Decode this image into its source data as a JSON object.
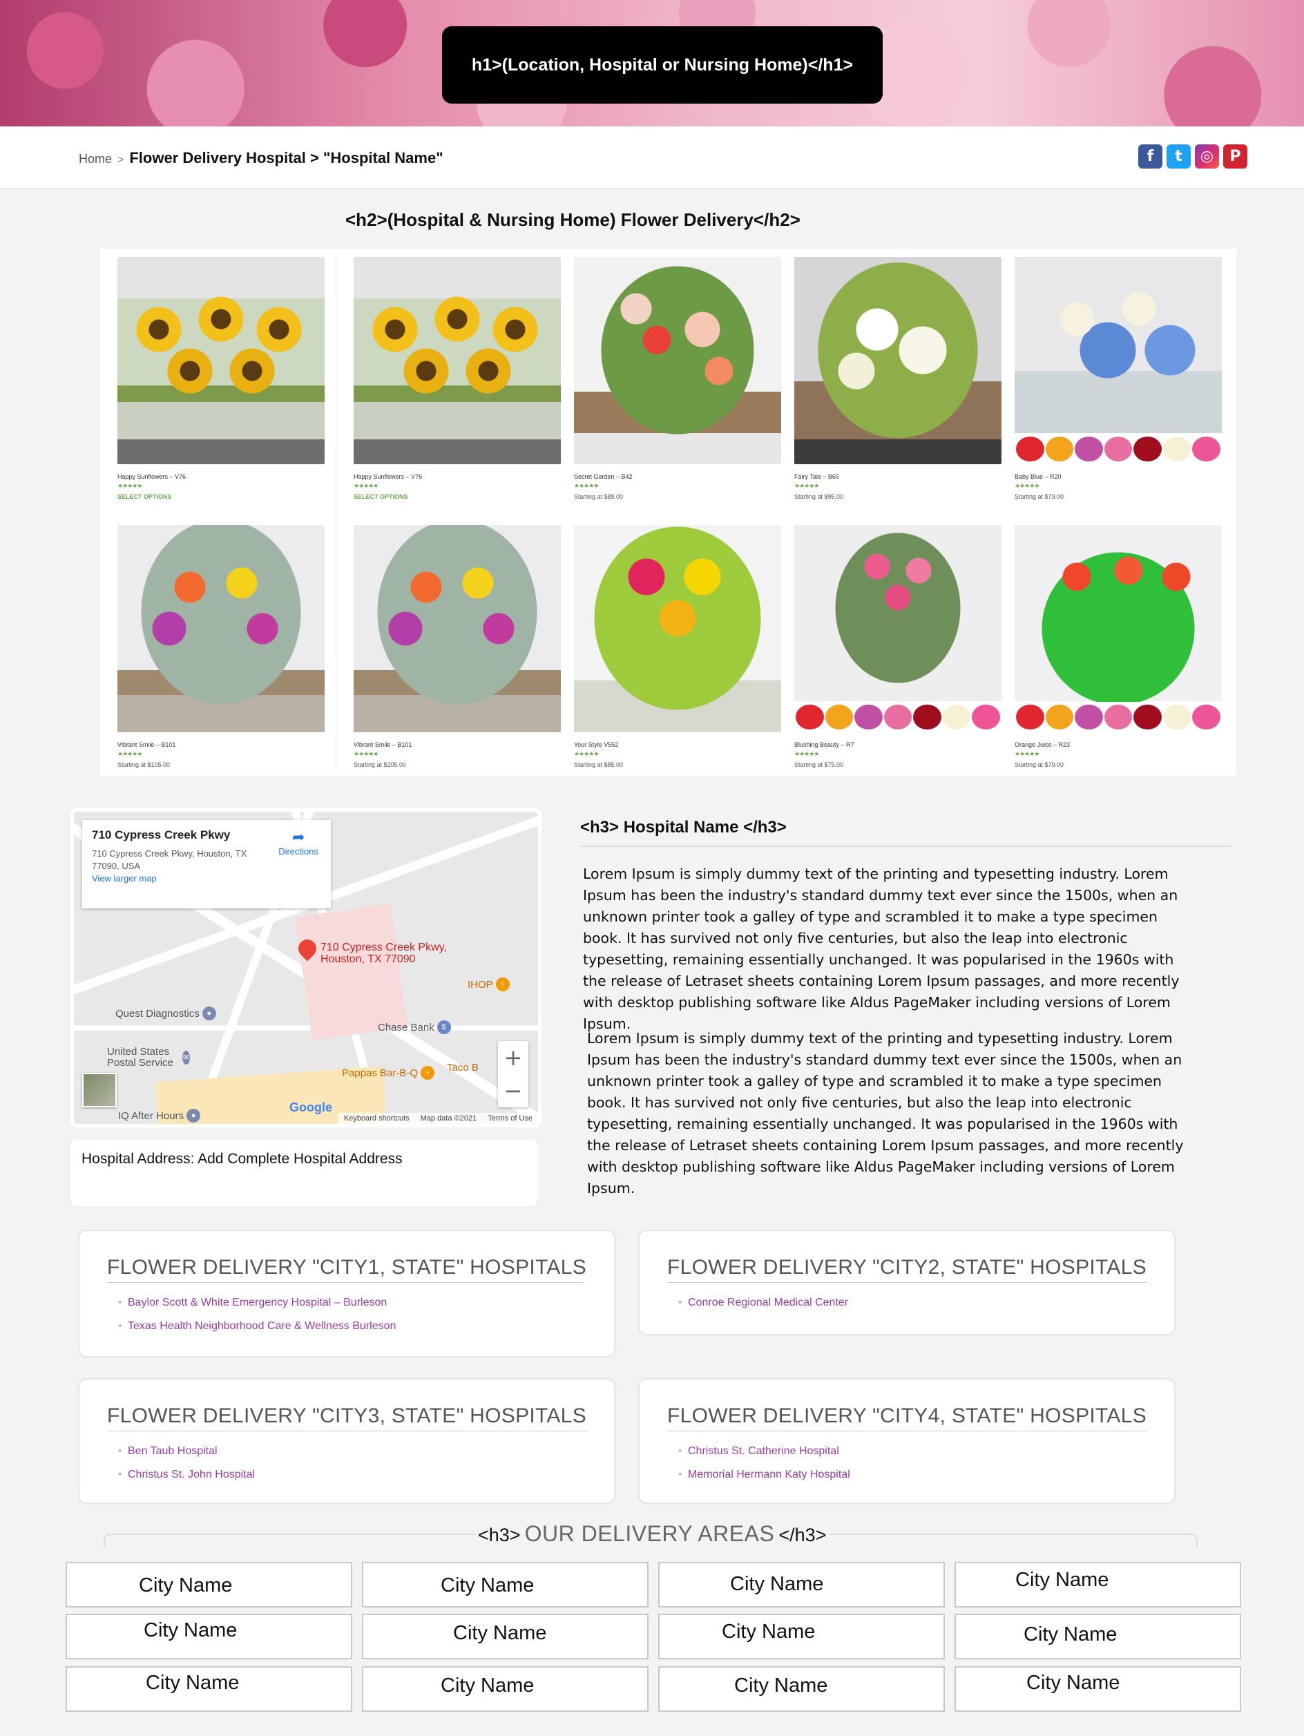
{
  "hero": {
    "title": "h1>(Location, Hospital or Nursing Home)</h1>"
  },
  "breadcrumb": {
    "home": "Home",
    "sep": ">",
    "current": "Flower Delivery Hospital > \"Hospital Name\""
  },
  "social": [
    {
      "name": "facebook",
      "glyph": "f"
    },
    {
      "name": "twitter",
      "glyph": "t"
    },
    {
      "name": "instagram",
      "glyph": "◎"
    },
    {
      "name": "pinterest",
      "glyph": "P"
    }
  ],
  "section_h2": "<h2>(Hospital & Nursing Home) Flower Delivery</h2>",
  "products": [
    {
      "name": "Happy Sunflowers – V76",
      "stars": "★★★★★",
      "price": "",
      "option": "SELECT OPTIONS"
    },
    {
      "name": "Happy Sunflowers – V76",
      "stars": "★★★★★",
      "price": "",
      "option": "SELECT OPTIONS"
    },
    {
      "name": "Secret Garden – B42",
      "stars": "★★★★★",
      "price": "Starting at $89.00",
      "option": ""
    },
    {
      "name": "Fairy Tale – B65",
      "stars": "★★★★★",
      "price": "Starting at $95.00",
      "option": ""
    },
    {
      "name": "Baby Blue – R20",
      "stars": "★★★★★",
      "price": "Starting at $79.00",
      "option": ""
    },
    {
      "name": "Vibrant Smile – B101",
      "stars": "★★★★★",
      "price": "Starting at $105.00",
      "option": ""
    },
    {
      "name": "Vibrant Smile – B101",
      "stars": "★★★★★",
      "price": "Starting at $105.00",
      "option": ""
    },
    {
      "name": "Your Style V552",
      "stars": "★★★★★",
      "price": "Starting at $85.00",
      "option": ""
    },
    {
      "name": "Blushing Beauty – R7",
      "stars": "★★★★★",
      "price": "Starting at $75.00",
      "option": ""
    },
    {
      "name": "Orange Juice – R23",
      "stars": "★★★★★",
      "price": "Starting at $79.00",
      "option": ""
    }
  ],
  "map": {
    "card_title": "710 Cypress Creek Pkwy",
    "card_address": "710 Cypress Creek Pkwy, Houston, TX 77090, USA",
    "directions": "Directions",
    "larger_map": "View larger map",
    "pin_label": "710 Cypress Creek Pkwy, Houston, TX 77090",
    "pois": [
      "Quest Diagnostics",
      "Chase Bank",
      "IHOP",
      "United States Postal Service",
      "Pappas Bar-B-Q",
      "Taco B",
      "IQ After Hours"
    ],
    "google": "Google",
    "footer": [
      "Keyboard shortcuts",
      "Map data ©2021",
      "Terms of Use"
    ],
    "zoom_in": "+",
    "zoom_out": "−"
  },
  "address": "Hospital Address:  Add Complete Hospital Address",
  "hospital": {
    "h3": "<h3> Hospital Name </h3>",
    "para1": "Lorem Ipsum is simply dummy text of the printing and typesetting industry. Lorem Ipsum has been the industry's standard dummy text ever since the 1500s, when an unknown printer took a galley of type and scrambled it to make a type specimen book. It has survived not only five centuries, but also the leap into electronic typesetting, remaining essentially unchanged. It was popularised in the 1960s with the release of Letraset sheets containing Lorem Ipsum passages, and more recently with desktop publishing software like Aldus PageMaker including versions of Lorem Ipsum.",
    "para2": "Lorem Ipsum is simply dummy text of the printing and typesetting industry. Lorem Ipsum has been the industry's standard dummy text ever since the 1500s, when an unknown printer took a galley of type and scrambled it to make a type specimen book. It has survived not only five centuries, but also the leap into electronic typesetting, remaining essentially unchanged. It was popularised in the 1960s with the release of Letraset sheets containing Lorem Ipsum passages, and more recently with desktop publishing software like Aldus PageMaker including versions of Lorem Ipsum."
  },
  "city_cards": [
    {
      "title": "FLOWER DELIVERY \"CITY1, STATE\" HOSPITALS",
      "items": [
        "Baylor Scott & White Emergency Hospital – Burleson",
        "Texas Health Neighborhood Care & Wellness Burleson"
      ]
    },
    {
      "title": "FLOWER DELIVERY \"CITY2, STATE\" HOSPITALS",
      "items": [
        "Conroe Regional Medical Center"
      ]
    },
    {
      "title": "FLOWER DELIVERY \"CITY3, STATE\" HOSPITALS",
      "items": [
        "Ben Taub Hospital",
        "Christus St. John Hospital"
      ]
    },
    {
      "title": "FLOWER DELIVERY \"CITY4, STATE\" HOSPITALS",
      "items": [
        "Christus St. Catherine Hospital",
        "Memorial Hermann Katy Hospital"
      ]
    }
  ],
  "delivery_areas": {
    "tag_open": "<h3>",
    "title": "OUR DELIVERY AREAS",
    "tag_close": "</h3>",
    "cities": [
      "City Name",
      "City Name",
      "City Name",
      "City Name",
      "City Name",
      "City Name",
      "City Name",
      "City Name",
      "City Name",
      "City Name",
      "City Name",
      "City Name"
    ]
  }
}
